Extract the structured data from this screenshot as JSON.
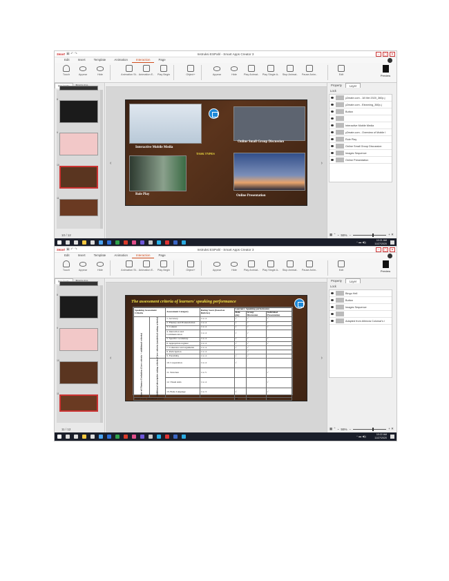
{
  "screens": [
    {
      "window_title": "Instruksi ESPahl - Smart Apps Creator 3",
      "logo": "Smart",
      "menu": [
        "Edit",
        "Insert",
        "Template",
        "Animation",
        "Interaction",
        "Page"
      ],
      "active_menu": "Interaction",
      "ribbon": [
        "Touch",
        "Appear",
        "Hide",
        "Animation St..",
        "Animation E..",
        "Play Begin",
        "Object+",
        "Appear",
        "Hide",
        "Play Animat..",
        "Play Single A..",
        "Stop Animat..",
        "Pause Anim..",
        "Edit",
        "Preview"
      ],
      "left_tabs": [
        "Navigate",
        "Resource"
      ],
      "page_indicator": "10 / 12",
      "thumb_numbers": [
        "8",
        "9",
        "10",
        "11"
      ],
      "right_tabs": [
        "Property",
        "Layer"
      ],
      "lock_label": "Lock",
      "layers": [
        "y2mate.com - 18 Mei 2020_360p.j",
        "y2mate.com - Elearning_360p.j",
        "Button",
        "",
        "Interactive Mobile Media",
        "y2mate.com - Overview of Mobile I",
        "Role Play",
        "Online Small Group Discussion",
        "Images Sequence",
        "Online Presentation"
      ],
      "zoom": "55%",
      "clock_time": "10:21 AM",
      "clock_date": "11/27/2020",
      "slide": {
        "labels": [
          "Interactive Mobile Media",
          "Online Small Group Discussion",
          "TASK TYPES",
          "Role Play",
          "Online Presentation"
        ]
      }
    },
    {
      "window_title": "Instruksi ESPahl - Smart Apps Creator 3",
      "logo": "Smart",
      "menu": [
        "Edit",
        "Insert",
        "Template",
        "Animation",
        "Interaction",
        "Page"
      ],
      "active_menu": "Interaction",
      "ribbon": [
        "Touch",
        "Appear",
        "Hide",
        "Animation St..",
        "Animation E..",
        "Play Begin",
        "Object+",
        "Appear",
        "Hide",
        "Play Animat..",
        "Play Single A..",
        "Stop Animat..",
        "Pause Anim..",
        "Edit",
        "Preview"
      ],
      "left_tabs": [
        "Navigate",
        "Resource"
      ],
      "page_indicator": "11 / 12",
      "thumb_numbers": [
        "8",
        "9",
        "10",
        "11"
      ],
      "right_tabs": [
        "Property",
        "Layer"
      ],
      "lock_label": "Lock",
      "layers": [
        "Bingo Hell",
        "Button",
        "Images Sequence",
        "",
        "Adapted from Allencia Colomar's i"
      ],
      "zoom": "55%",
      "clock_time": "10:22 AM",
      "clock_date": "11/27/2020",
      "slide": {
        "title": "The assessment criteria of learners' speaking performance",
        "header": {
          "c1": "Speaking Assessment Criteria",
          "c2": "Assessment Category",
          "c3": "Rating Score (based on Rubrics)",
          "c4": "Learners' Speaking performance",
          "sub": [
            "Role-play",
            "Group Discussion",
            "Individual Presentation"
          ]
        },
        "group_outer": "Rate of Fluency Evolution (Core criteria + additional criteria)",
        "group_core": "Core criteria (analytical rating criteria)",
        "group_add": "Additional descriptive rating criteria",
        "rows": [
          [
            "1.  Accuracy",
            "1 to 4",
            "√",
            "√",
            "√"
          ],
          [
            "2.  Fluency and Pronunciation",
            "1 to 4",
            "√",
            "√",
            "√"
          ],
          [
            "3.  Content",
            "1 to 4",
            "√",
            "√",
            "√"
          ],
          [
            "4.  Interaction and Communication",
            "1 to 4",
            "√",
            "√",
            ""
          ],
          [
            "5.  Specific vocabulary",
            "1 to 4",
            "√",
            "√",
            "√"
          ],
          [
            "6.  Appropriate register",
            "1 to 4",
            "√",
            "√",
            "√"
          ],
          [
            "7.  Coherence and arguments",
            "1 to 4",
            "√",
            "√",
            ""
          ],
          [
            "8.  Participation",
            "1 to 4",
            "",
            "√",
            ""
          ],
          [
            "9.  Flexibility",
            "1 to 4",
            "√",
            "√",
            ""
          ],
          [
            "10. Cooperation",
            "1 to 4",
            "√",
            "",
            ""
          ],
          [
            "11. Structure",
            "1 to 5",
            "",
            "",
            "√"
          ],
          [
            "12. Visual Aids",
            "1 to 4",
            "",
            "",
            "√"
          ],
          [
            "13. Body Language",
            "1 to 3",
            "√",
            "",
            "√"
          ]
        ],
        "total_label": "Total Score (maximal score)",
        "totals": [
          "28",
          "26",
          "25"
        ]
      }
    }
  ]
}
